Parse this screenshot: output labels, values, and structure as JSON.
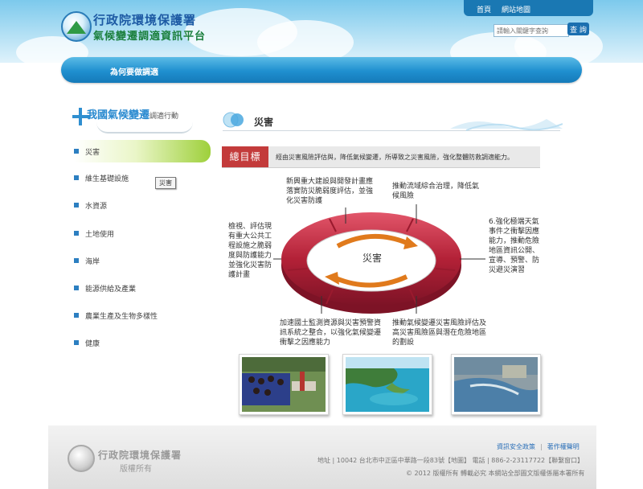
{
  "header": {
    "title": "行政院環境保護署",
    "subtitle": "氣候變遷調適資訊平台",
    "nav": [
      "首頁",
      "網站地圖"
    ],
    "search_placeholder": "請輸入關鍵字查詢",
    "search_button": "查 詢"
  },
  "banner": {
    "label": "為何要做調適"
  },
  "sidebar": {
    "title": "我國氣候變遷",
    "title_suffix": "調適行動",
    "items": [
      {
        "label": "災害"
      },
      {
        "label": "維生基礎設施"
      },
      {
        "label": "水資源"
      },
      {
        "label": "土地使用"
      },
      {
        "label": "海岸"
      },
      {
        "label": "能源供給及產業"
      },
      {
        "label": "農業生產及生物多樣性"
      },
      {
        "label": "健康"
      }
    ],
    "tooltip": "災害"
  },
  "main": {
    "title": "災害",
    "goal_label": "總目標",
    "goal_text": "經由災害風險評估與，降低氣候變遷，所導致之災害風險，強化整體防救調適能力。",
    "diagram": {
      "center": "災害",
      "strategies": [
        "新興重大建設與開發計畫應落實防災脆弱度評估，並強化災害防護",
        "推動流域綜合治理，降低氣候風險",
        "6.強化極端天氣事件之衝擊因應能力，推動危險地區資訊公開、宣導、預警、防災避災演習",
        "推動氣候變遷災害風險評估及高災害風險區與潛在危險地區的劃設",
        "加速國土監測資源與災害預警資訊系統之整合，以強化氣候變遷衝擊之因應能力",
        "檢視、評估現有重大公共工程設施之脆弱度與防護能力並強化災害防護計畫"
      ]
    }
  },
  "footer": {
    "org": "行政院環境保護署",
    "rights": "版權所有",
    "links": [
      "資訊安全政策",
      "著作權聲明"
    ],
    "address": "地址 | 10042 台北市中正區中華路一段83號【地圖】 電話 | 886-2-23117722【聯繫窗口】",
    "copyright": "© 2012 版權所有 轉載必究 本網站全部圖文版權係屬本署所有"
  },
  "colors": {
    "header_sky": "#7cc9ec",
    "banner": "#1f8fcf",
    "goal_red": "#c33b3b",
    "ring_red": "#b32137",
    "arrow_orange": "#e07a1c",
    "active_green": "#9ed03b"
  }
}
